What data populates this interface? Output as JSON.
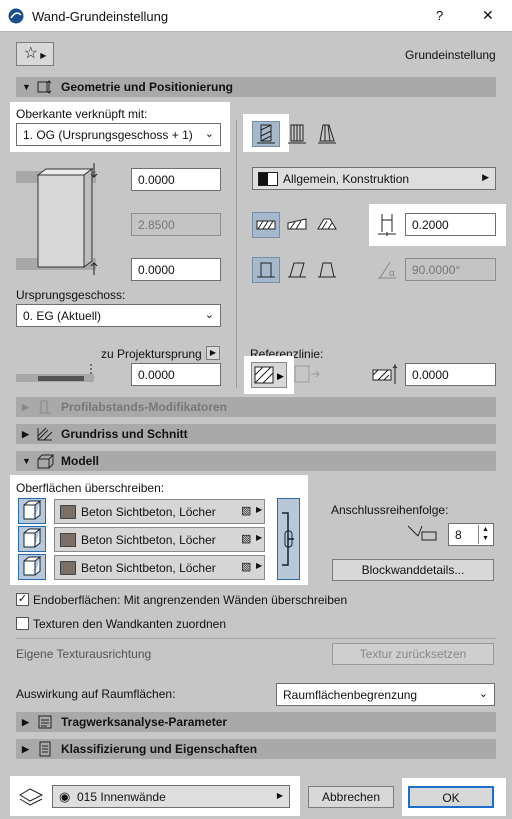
{
  "window": {
    "title": "Wand-Grundeinstellung",
    "help": "?",
    "close": "✕"
  },
  "favorites": {
    "label": "Grundeinstellung"
  },
  "sections": {
    "geometry": "Geometrie und Positionierung",
    "profile": "Profilabstands-Modifikatoren",
    "floorplan": "Grundriss und Schnitt",
    "model": "Modell",
    "structural": "Tragwerksanalyse-Parameter",
    "classification": "Klassifizierung und Eigenschaften"
  },
  "geometry": {
    "top_link_label": "Oberkante verknüpft mit:",
    "top_link_value": "1. OG (Ursprungsgeschoss + 1)",
    "top_offset": "0.0000",
    "height": "2.8500",
    "bottom_offset": "0.0000",
    "home_story_label": "Ursprungsgeschoss:",
    "home_story_value": "0. EG (Aktuell)",
    "to_project_zero": "zu Projektursprung",
    "project_zero_value": "0.0000",
    "building_material": "Allgemein, Konstruktion",
    "thickness": "0.2000",
    "slant_angle": "90.0000°",
    "reference_line_label": "Referenzlinie:",
    "reference_offset": "0.0000"
  },
  "model": {
    "override_label": "Oberflächen überschreiben:",
    "surfaces": [
      "Beton Sichtbeton, Löcher",
      "Beton Sichtbeton, Löcher",
      "Beton Sichtbeton, Löcher"
    ],
    "connection_label": "Anschlussreihenfolge:",
    "connection_value": "8",
    "block_button": "Blockwanddetails...",
    "end_surfaces_label": "Endoberflächen: Mit angrenzenden Wänden überschreiben",
    "end_surfaces_checked": true,
    "textures_label": "Texturen den Wandkanten zuordnen",
    "textures_checked": false,
    "custom_texture_label": "Eigene Texturausrichtung",
    "reset_texture_button": "Textur zurücksetzen",
    "zone_label": "Auswirkung auf Raumflächen:",
    "zone_value": "Raumflächenbegrenzung"
  },
  "footer": {
    "layer_value": "015 Innenwände",
    "cancel": "Abbrechen",
    "ok": "OK"
  },
  "colors": {
    "accent": "#1c6fc9",
    "highlight_bg": "#ffffff",
    "section_bg": "#a9a9a9"
  }
}
